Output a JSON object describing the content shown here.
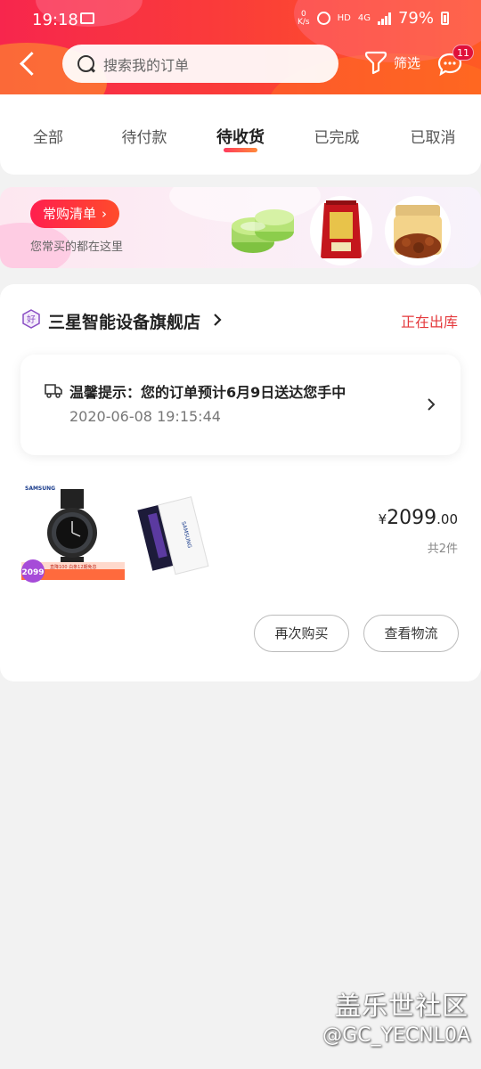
{
  "status_bar": {
    "time": "19:18",
    "net_speed_value": "0",
    "net_speed_unit": "K/s",
    "hd": "HD",
    "network": "4G",
    "battery": "79%"
  },
  "header": {
    "search_placeholder": "搜索我的订单",
    "filter_label": "筛选",
    "message_badge": "11",
    "accent_gradient": [
      "#f7264d",
      "#ff5a23"
    ]
  },
  "tabs": {
    "items": [
      {
        "label": "全部"
      },
      {
        "label": "待付款"
      },
      {
        "label": "待收货",
        "active": true
      },
      {
        "label": "已完成"
      },
      {
        "label": "已取消"
      }
    ]
  },
  "banner": {
    "button_label": "常购清单",
    "button_arrow": "›",
    "subtitle": "您常买的都在这里"
  },
  "order": {
    "shop_name": "三星智能设备旗舰店",
    "shop_chevron": "›",
    "status": "正在出库",
    "status_color": "#e4393c",
    "tip_text": "温馨提示：您的订单预计6月9日送达您手中",
    "tip_time": "2020-06-08 19:15:44",
    "products": [
      {
        "brand": "SAMSUNG",
        "promo_price": "2099",
        "promo_text": "直降100 白条12期免息"
      },
      {
        "brand": "SAMSUNG"
      }
    ],
    "price_symbol": "¥",
    "price_int": "2099",
    "price_dec": ".00",
    "quantity": "共2件",
    "buttons": {
      "rebuy": "再次购买",
      "logistics": "查看物流"
    }
  },
  "watermark": {
    "title": "盖乐世社区",
    "user": "@GC_YECNL0A"
  }
}
